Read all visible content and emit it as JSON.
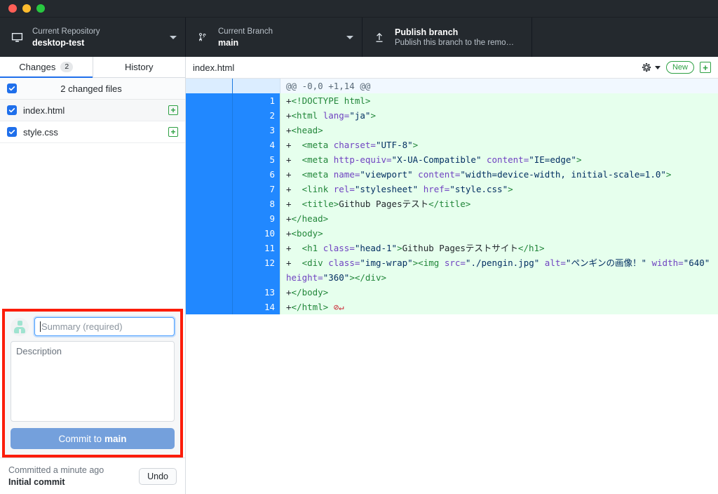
{
  "window": {
    "traffic_lights": [
      "close",
      "minimize",
      "maximize"
    ]
  },
  "toolbar": {
    "repository": {
      "label": "Current Repository",
      "value": "desktop-test",
      "icon": "desktop-icon"
    },
    "branch": {
      "label": "Current Branch",
      "value": "main",
      "icon": "branch-icon"
    },
    "publish": {
      "title": "Publish branch",
      "subtitle": "Publish this branch to the remo…",
      "icon": "upload-icon"
    }
  },
  "sidebar": {
    "tabs": [
      {
        "label": "Changes",
        "count": "2",
        "active": true
      },
      {
        "label": "History",
        "count": "",
        "active": false
      }
    ],
    "files_header": "2 changed files",
    "files": [
      {
        "name": "index.html",
        "status": "+",
        "checked": true
      },
      {
        "name": "style.css",
        "status": "+",
        "checked": true
      }
    ],
    "commit_form": {
      "summary_placeholder": "Summary (required)",
      "summary_value": "",
      "description_placeholder": "Description",
      "description_value": "",
      "commit_button_prefix": "Commit to ",
      "commit_button_branch": "main"
    },
    "status": {
      "line1": "Committed a minute ago",
      "line2": "Initial commit",
      "undo_label": "Undo"
    }
  },
  "diff": {
    "file_name": "index.html",
    "new_badge": "New",
    "hunk_header": "@@ -0,0 +1,14 @@",
    "lines": [
      {
        "num": "1",
        "marker": "+",
        "parts": [
          {
            "t": "tg",
            "v": "<!DOCTYPE html>"
          }
        ]
      },
      {
        "num": "2",
        "marker": "+",
        "parts": [
          {
            "t": "tg",
            "v": "<html "
          },
          {
            "t": "at",
            "v": "lang="
          },
          {
            "t": "st",
            "v": "\"ja\""
          },
          {
            "t": "tg",
            "v": ">"
          }
        ]
      },
      {
        "num": "3",
        "marker": "+",
        "parts": [
          {
            "t": "tg",
            "v": "<head>"
          }
        ]
      },
      {
        "num": "4",
        "marker": "+",
        "parts": [
          {
            "t": "tx",
            "v": "  "
          },
          {
            "t": "tg",
            "v": "<meta "
          },
          {
            "t": "at",
            "v": "charset="
          },
          {
            "t": "st",
            "v": "\"UTF-8\""
          },
          {
            "t": "tg",
            "v": ">"
          }
        ]
      },
      {
        "num": "5",
        "marker": "+",
        "parts": [
          {
            "t": "tx",
            "v": "  "
          },
          {
            "t": "tg",
            "v": "<meta "
          },
          {
            "t": "at",
            "v": "http-equiv="
          },
          {
            "t": "st",
            "v": "\"X-UA-Compatible\""
          },
          {
            "t": "at",
            "v": " content="
          },
          {
            "t": "st",
            "v": "\"IE=edge\""
          },
          {
            "t": "tg",
            "v": ">"
          }
        ]
      },
      {
        "num": "6",
        "marker": "+",
        "parts": [
          {
            "t": "tx",
            "v": "  "
          },
          {
            "t": "tg",
            "v": "<meta "
          },
          {
            "t": "at",
            "v": "name="
          },
          {
            "t": "st",
            "v": "\"viewport\""
          },
          {
            "t": "at",
            "v": " content="
          },
          {
            "t": "st",
            "v": "\"width=device-width, initial-scale=1.0\""
          },
          {
            "t": "tg",
            "v": ">"
          }
        ]
      },
      {
        "num": "7",
        "marker": "+",
        "parts": [
          {
            "t": "tx",
            "v": "  "
          },
          {
            "t": "tg",
            "v": "<link "
          },
          {
            "t": "at",
            "v": "rel="
          },
          {
            "t": "st",
            "v": "\"stylesheet\""
          },
          {
            "t": "at",
            "v": " href="
          },
          {
            "t": "st",
            "v": "\"style.css\""
          },
          {
            "t": "tg",
            "v": ">"
          }
        ]
      },
      {
        "num": "8",
        "marker": "+",
        "parts": [
          {
            "t": "tx",
            "v": "  "
          },
          {
            "t": "tg",
            "v": "<title>"
          },
          {
            "t": "tx",
            "v": "Github Pagesテスト"
          },
          {
            "t": "tg",
            "v": "</title>"
          }
        ]
      },
      {
        "num": "9",
        "marker": "+",
        "parts": [
          {
            "t": "tg",
            "v": "</head>"
          }
        ]
      },
      {
        "num": "10",
        "marker": "+",
        "parts": [
          {
            "t": "tg",
            "v": "<body>"
          }
        ]
      },
      {
        "num": "11",
        "marker": "+",
        "parts": [
          {
            "t": "tx",
            "v": "  "
          },
          {
            "t": "tg",
            "v": "<h1 "
          },
          {
            "t": "at",
            "v": "class="
          },
          {
            "t": "st",
            "v": "\"head-1\""
          },
          {
            "t": "tg",
            "v": ">"
          },
          {
            "t": "tx",
            "v": "Github Pagesテストサイト"
          },
          {
            "t": "tg",
            "v": "</h1>"
          }
        ]
      },
      {
        "num": "12",
        "marker": "+",
        "parts": [
          {
            "t": "tx",
            "v": "  "
          },
          {
            "t": "tg",
            "v": "<div "
          },
          {
            "t": "at",
            "v": "class="
          },
          {
            "t": "st",
            "v": "\"img-wrap\""
          },
          {
            "t": "tg",
            "v": "><img "
          },
          {
            "t": "at",
            "v": "src="
          },
          {
            "t": "st",
            "v": "\"./pengin.jpg\""
          },
          {
            "t": "at",
            "v": " alt="
          },
          {
            "t": "st",
            "v": "\"ペンギンの画像！\""
          },
          {
            "t": "at",
            "v": " width="
          },
          {
            "t": "st",
            "v": "\"640\""
          },
          {
            "t": "at",
            "v": " height="
          },
          {
            "t": "st",
            "v": "\"360\""
          },
          {
            "t": "tg",
            "v": "></div>"
          }
        ]
      },
      {
        "num": "13",
        "marker": "+",
        "parts": [
          {
            "t": "tg",
            "v": "</body>"
          }
        ]
      },
      {
        "num": "14",
        "marker": "+",
        "parts": [
          {
            "t": "tg",
            "v": "</html>"
          },
          {
            "t": "nonl",
            "v": " ⊘↵"
          }
        ]
      }
    ]
  },
  "colors": {
    "toolbar_bg": "#24292e",
    "accent_blue": "#1f6feb",
    "gutter_blue": "#2188ff",
    "diff_add_bg": "#e6ffed",
    "hunk_bg": "#f1f8ff",
    "green": "#2ea043",
    "annotation_red": "#fc1d0a",
    "commit_button": "#74a0dc"
  }
}
